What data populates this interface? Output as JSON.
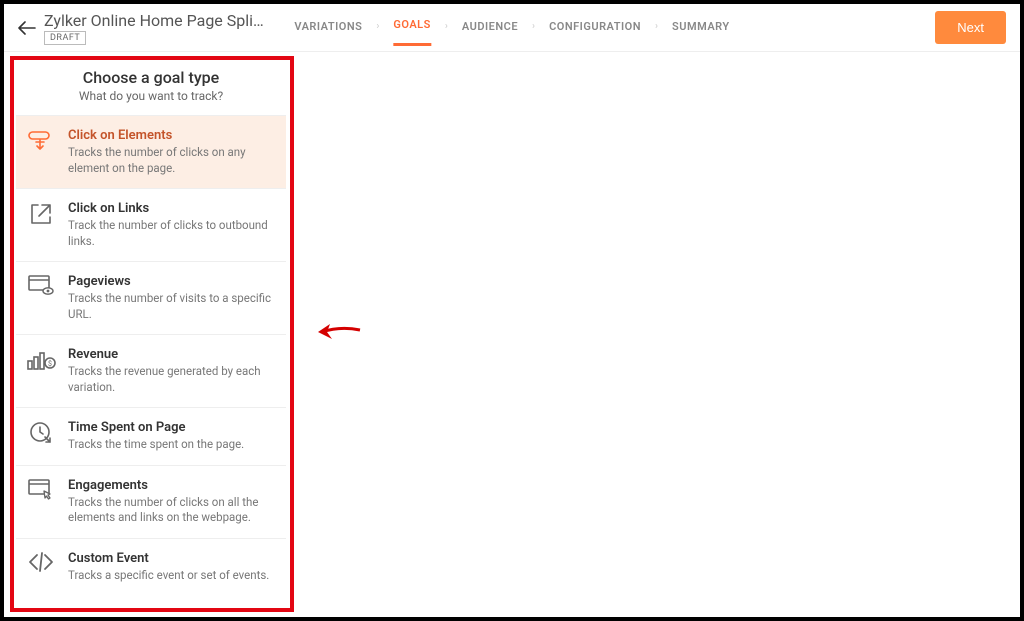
{
  "header": {
    "title": "Zylker Online Home Page Spli…",
    "status": "DRAFT",
    "next_label": "Next"
  },
  "crumbs": [
    {
      "label": "VARIATIONS",
      "active": false
    },
    {
      "label": "GOALS",
      "active": true
    },
    {
      "label": "AUDIENCE",
      "active": false
    },
    {
      "label": "CONFIGURATION",
      "active": false
    },
    {
      "label": "SUMMARY",
      "active": false
    }
  ],
  "panel": {
    "title": "Choose a goal type",
    "subtitle": "What do you want to track?"
  },
  "goals": [
    {
      "icon": "click-element",
      "title": "Click on Elements",
      "desc": "Tracks the number of clicks on any element on the page.",
      "selected": true
    },
    {
      "icon": "external-link",
      "title": "Click on Links",
      "desc": "Track the number of clicks to outbound links.",
      "selected": false
    },
    {
      "icon": "pageviews",
      "title": "Pageviews",
      "desc": "Tracks the number of visits to a specific URL.",
      "selected": false
    },
    {
      "icon": "revenue",
      "title": "Revenue",
      "desc": "Tracks the revenue generated by each variation.",
      "selected": false
    },
    {
      "icon": "clock",
      "title": "Time Spent on Page",
      "desc": "Tracks the time spent on the page.",
      "selected": false
    },
    {
      "icon": "engagements",
      "title": "Engagements",
      "desc": "Tracks the number of clicks on all the elements and links on the webpage.",
      "selected": false
    },
    {
      "icon": "code",
      "title": "Custom Event",
      "desc": "Tracks a specific event or set of events.",
      "selected": false
    }
  ]
}
